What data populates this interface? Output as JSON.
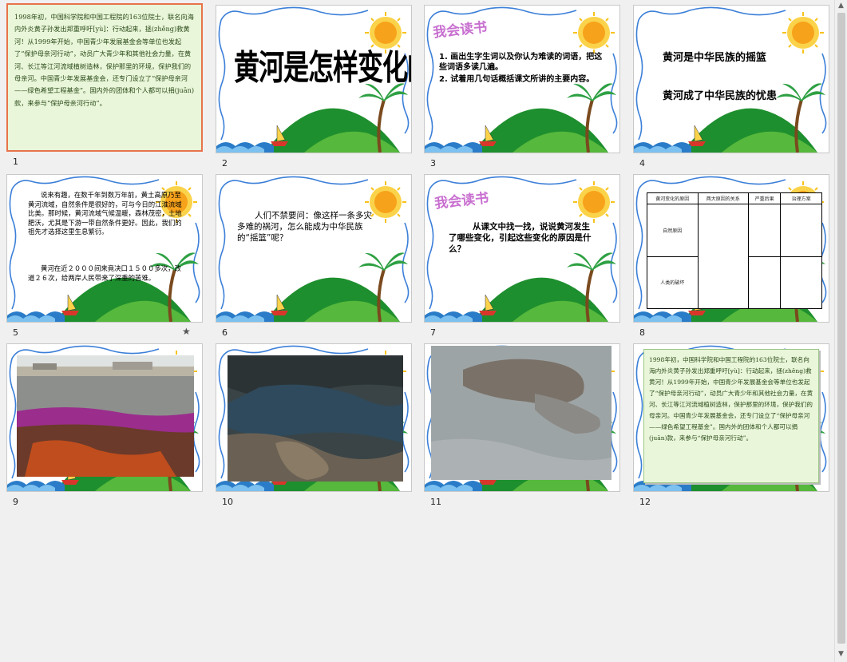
{
  "slides": [
    {
      "number": "1",
      "text": "1998年初，中国科学院和中国工程院的163位院士，联名向海内外炎黄子孙发出郑重呼吁[yù]：行动起来，拯(zhěng)救黄河！从1999年开始，中国青少年发展基金会等单位也发起了“保护母亲河行动”，动员广大青少年和其他社会力量，在黄河、长江等江河流域植树造林，保护那里的环境，保护我们的母亲河。中国青少年发展基金会，还专门设立了“保护母亲河——绿色希望工程基金”。国内外的团体和个人都可以捐(juān)款，来参与“保护母亲河行动”。"
    },
    {
      "number": "2",
      "title": "黄河是怎样变化的"
    },
    {
      "number": "3",
      "heading": "我会读书",
      "items": [
        "1. 画出生字生词以及你认为难读的词语，把这些词语多读几遍。",
        "2. 试着用几句话概括课文所讲的主要内容。"
      ]
    },
    {
      "number": "4",
      "line1": "黄河是中华民族的摇篮",
      "line2": "黄河成了中华民族的忧患"
    },
    {
      "number": "5",
      "para1": "说来有趣，在数千年到数万年前，黄土高原乃至黄河流域，自然条件是很好的，可与今日的江淮流域比美。那时候，黄河流域气候温暖，森林茂密，土地肥沃，尤其是下游一带自然条件更好。因此，我们的祖先才选择这里生息繁衍。",
      "para2": "黄河在近２０００间来竟决口１５００多次，改道２６次，给两岸人民带来了深重的苦难。",
      "star": "★"
    },
    {
      "number": "6",
      "text": "人们不禁要问：像这样一条多灾多难的祸河，怎么能成为中华民族的“摇篮”呢？"
    },
    {
      "number": "7",
      "heading": "我会读书",
      "text": "从课文中找一找，说说黄河发生了哪些变化，引起这些变化的原因是什么？"
    },
    {
      "number": "8",
      "headers": [
        "黄河变化的原因",
        "两大原因的关系",
        "严重后果",
        "治理方案"
      ],
      "rows": [
        "自然原因",
        "人类的破坏"
      ]
    },
    {
      "number": "9"
    },
    {
      "number": "10"
    },
    {
      "number": "11"
    },
    {
      "number": "12"
    }
  ],
  "colors": {
    "selected_border": "#e8734a",
    "heading_purple": "#c86fd0",
    "sun": "#f7a21b",
    "hill": "#1e8f2e",
    "wave": "#2a7cc8"
  }
}
